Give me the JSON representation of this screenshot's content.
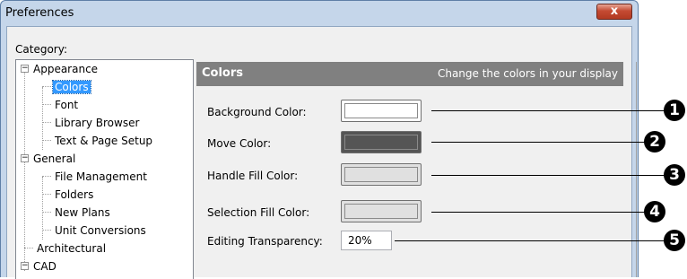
{
  "window": {
    "title": "Preferences",
    "close_label": "x"
  },
  "category_label": "Category:",
  "tree": {
    "groups": [
      {
        "label": "Appearance",
        "expander": "−",
        "children": [
          "Colors",
          "Font",
          "Library Browser",
          "Text & Page Setup"
        ]
      },
      {
        "label": "General",
        "expander": "−",
        "children": [
          "File Management",
          "Folders",
          "New Plans",
          "Unit Conversions"
        ]
      },
      {
        "label": "Architectural"
      },
      {
        "label": "CAD",
        "expander": "−"
      }
    ],
    "selected": "Colors"
  },
  "panel": {
    "title": "Colors",
    "subtitle": "Change the colors in your display"
  },
  "fields": [
    {
      "label": "Background Color:",
      "color": "#ffffff",
      "callout": "1"
    },
    {
      "label": "Move Color:",
      "color": "#555555",
      "callout": "2"
    },
    {
      "label": "Handle Fill Color:",
      "color": "#e0e0e0",
      "callout": "3"
    },
    {
      "label": "Selection Fill Color:",
      "color": "#e0e0e0",
      "callout": "4"
    },
    {
      "label": "Editing Transparency:",
      "value": "20%",
      "callout": "5"
    }
  ]
}
